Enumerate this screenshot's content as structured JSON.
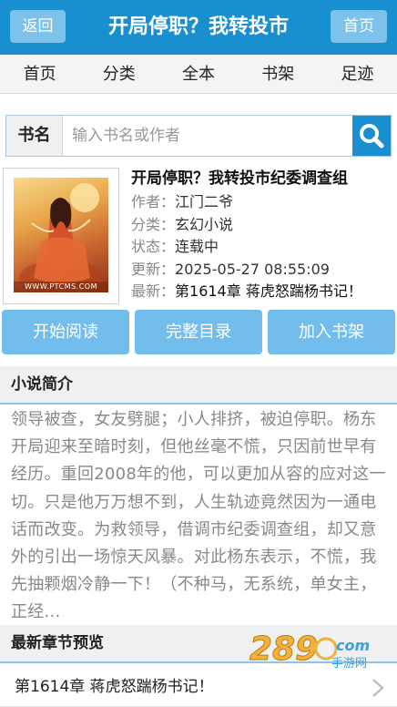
{
  "header": {
    "back_label": "返回",
    "title": "开局停职？我转投市",
    "home_label": "首页"
  },
  "nav": {
    "items": [
      "首页",
      "分类",
      "全本",
      "书架",
      "足迹"
    ]
  },
  "search": {
    "label": "书名",
    "placeholder": "输入书名或作者",
    "button_icon": "search-icon"
  },
  "book": {
    "cover_caption": "WWW.PTCMS.COM",
    "title": "开局停职？我转投市纪委调查组",
    "author_key": "作者：",
    "author": "江门二爷",
    "category_key": "分类：",
    "category": "玄幻小说",
    "status_key": "状态：",
    "status": "连载中",
    "updated_key": "更新：",
    "updated": "2025-05-27 08:55:09",
    "latest_key": "最新：",
    "latest": "第1614章 蒋虎怒踹杨书记！"
  },
  "actions": {
    "read": "开始阅读",
    "catalog": "完整目录",
    "shelf": "加入书架"
  },
  "intro": {
    "heading": "小说简介",
    "text": "领导被查，女友劈腿；小人排挤，被迫停职。杨东开局迎来至暗时刻，但他丝毫不慌，只因前世早有经历。重回2008年的他，可以更加从容的应对这一切。只是他万万想不到，人生轨迹竟然因为一通电话而改变。为救领导，借调市纪委调查组，却又意外的引出一场惊天风暴。对此杨东表示，不慌，我先抽颗烟冷静一下！（不种马，无系统，单女主，正经..."
  },
  "latest": {
    "heading": "最新章节预览",
    "item": "第1614章 蒋虎怒踹杨书记！"
  },
  "watermark": {
    "brand": "289",
    "sub": "手游网",
    "suffix": "com"
  },
  "colors": {
    "header": "#1a8fd0",
    "button": "#72bdec",
    "section_bg": "#eef0f2",
    "section_border": "#8dc4ea"
  }
}
